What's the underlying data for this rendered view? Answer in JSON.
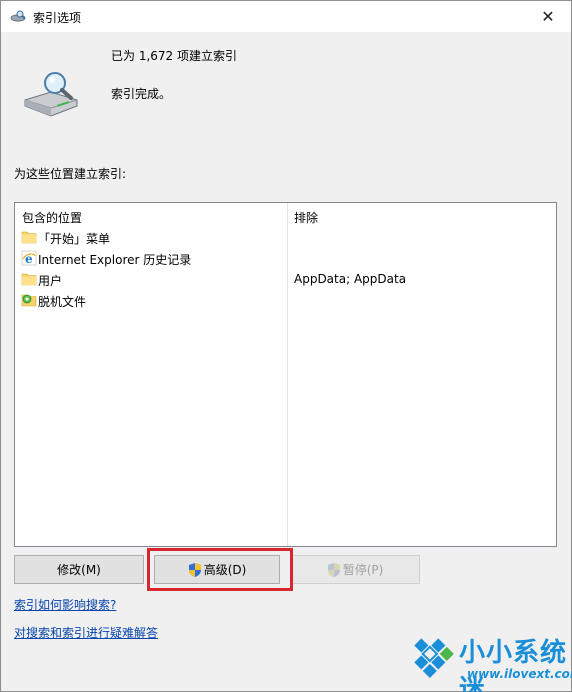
{
  "window": {
    "title": "索引选项",
    "close_glyph": "✕"
  },
  "status": {
    "count_text": "已为 1,672 项建立索引",
    "done_text": "索引完成。"
  },
  "locations": {
    "section_label": "为这些位置建立索引:",
    "col_included": "包含的位置",
    "col_excluded": "排除",
    "rows": [
      {
        "name": "「开始」菜单",
        "excluded": "",
        "icon": "folder-icon"
      },
      {
        "name": "Internet Explorer 历史记录",
        "excluded": "",
        "icon": "ie-icon"
      },
      {
        "name": "用户",
        "excluded": "AppData; AppData",
        "icon": "folder-icon"
      },
      {
        "name": "脱机文件",
        "excluded": "",
        "icon": "offline-files-icon"
      }
    ]
  },
  "buttons": {
    "modify": "修改(M)",
    "advanced": "高级(D)",
    "pause": "暂停(P)"
  },
  "links": {
    "how_affects": "索引如何影响搜索?",
    "troubleshoot": "对搜索和索引进行疑难解答"
  },
  "watermark": {
    "text": "小小系统迷",
    "url": "www.ilovext.com"
  },
  "colors": {
    "highlight": "#d9262c",
    "link": "#0645ad",
    "watermark": "#1a8fd8"
  }
}
